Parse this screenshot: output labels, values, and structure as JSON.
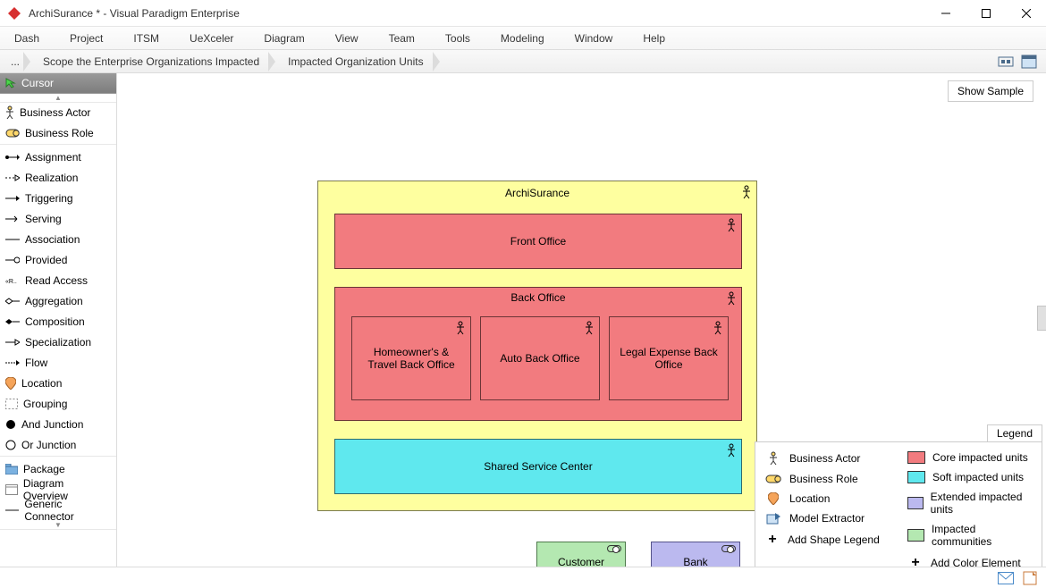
{
  "window": {
    "title": "ArchiSurance * - Visual Paradigm Enterprise"
  },
  "menu": [
    "Dash",
    "Project",
    "ITSM",
    "UeXceler",
    "Diagram",
    "View",
    "Team",
    "Tools",
    "Modeling",
    "Window",
    "Help"
  ],
  "breadcrumb": {
    "dots": "...",
    "a": "Scope the Enterprise Organizations Impacted",
    "b": "Impacted Organization Units"
  },
  "palette": {
    "cursor": "Cursor",
    "items1": [
      "Business Actor",
      "Business Role"
    ],
    "items2": [
      "Assignment",
      "Realization",
      "Triggering",
      "Serving",
      "Association",
      "Provided",
      "Read Access",
      "Aggregation",
      "Composition",
      "Specialization",
      "Flow",
      "Location",
      "Grouping",
      "And Junction",
      "Or Junction"
    ],
    "items3": [
      "Package",
      "Diagram Overview",
      "Generic Connector"
    ]
  },
  "buttons": {
    "show_sample": "Show Sample"
  },
  "diagram": {
    "archisurance": "ArchiSurance",
    "front_office": "Front Office",
    "back_office": "Back Office",
    "ho_travel": "Homeowner's & Travel Back Office",
    "auto": "Auto Back Office",
    "legal": "Legal Expense Back Office",
    "ssc": "Shared Service Center",
    "customer": "Customer",
    "bank": "Bank"
  },
  "legend": {
    "title": "Legend",
    "left": [
      "Business Actor",
      "Business Role",
      "Location",
      "Model Extractor",
      "Add Shape Legend"
    ],
    "right": [
      "Core impacted units",
      "Soft impacted units",
      "Extended impacted units",
      "Impacted communities",
      "Add Color Element"
    ],
    "colors": [
      "#f27b7f",
      "#5fe8ee",
      "#bbb9ef",
      "#b4e8b1"
    ]
  }
}
